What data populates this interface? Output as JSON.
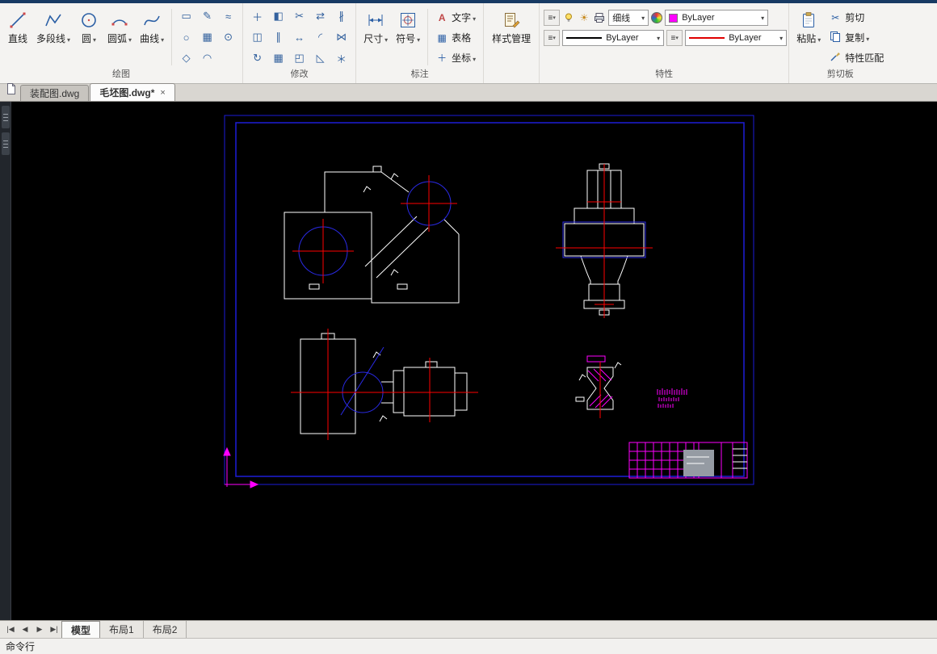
{
  "ribbon": {
    "panels": {
      "draw": {
        "label": "绘图",
        "big_buttons": [
          {
            "label": "直线"
          },
          {
            "label": "多段线"
          },
          {
            "label": "圆"
          },
          {
            "label": "圆弧"
          },
          {
            "label": "曲线"
          }
        ],
        "small_icons": [
          {
            "name": "rectangle",
            "glyph": "▭"
          },
          {
            "name": "ellipse",
            "glyph": "○"
          },
          {
            "name": "polygon",
            "glyph": "◇"
          },
          {
            "name": "sketch",
            "glyph": "✎"
          },
          {
            "name": "hatch",
            "glyph": "▦"
          },
          {
            "name": "arc-small",
            "glyph": "◠"
          },
          {
            "name": "wave",
            "glyph": "≈"
          },
          {
            "name": "point",
            "glyph": "⊙"
          }
        ]
      },
      "modify": {
        "label": "修改",
        "icons": [
          {
            "name": "move",
            "glyph": "＋"
          },
          {
            "name": "copy",
            "glyph": "◫"
          },
          {
            "name": "rotate",
            "glyph": "↻"
          },
          {
            "name": "mirror",
            "glyph": "◧"
          },
          {
            "name": "offset",
            "glyph": "∥"
          },
          {
            "name": "array",
            "glyph": "▦"
          },
          {
            "name": "trim",
            "glyph": "✂"
          },
          {
            "name": "extend",
            "glyph": "↔"
          },
          {
            "name": "scale",
            "glyph": "◰"
          },
          {
            "name": "stretch",
            "glyph": "⇄"
          },
          {
            "name": "fillet",
            "glyph": "◜"
          },
          {
            "name": "chamfer",
            "glyph": "◺"
          },
          {
            "name": "break",
            "glyph": "∦"
          },
          {
            "name": "join",
            "glyph": "⋈"
          },
          {
            "name": "explode",
            "glyph": "＊"
          }
        ]
      },
      "annotate": {
        "label": "标注",
        "big_buttons": [
          {
            "label": "尺寸"
          },
          {
            "label": "符号"
          }
        ],
        "small_buttons": [
          {
            "label": "文字"
          },
          {
            "label": "表格"
          },
          {
            "label": "坐标"
          }
        ]
      },
      "style": {
        "button_label": "样式管理"
      },
      "properties": {
        "label": "特性",
        "lineweight_value": "细线",
        "color_value": "ByLayer",
        "linetype_value": "ByLayer",
        "dimstyle_value": "ByLayer",
        "color_swatch": "#ff00ff",
        "linetype_sample_color": "#000000",
        "dimline_sample_color": "#e00000"
      },
      "clipboard": {
        "label": "剪切板",
        "paste_label": "粘贴",
        "small_buttons": [
          {
            "label": "剪切"
          },
          {
            "label": "复制"
          },
          {
            "label": "特性匹配"
          }
        ]
      }
    }
  },
  "document_tabs": {
    "tabs": [
      {
        "label": "装配图.dwg",
        "active": false
      },
      {
        "label": "毛坯图.dwg*",
        "active": true
      }
    ],
    "close_glyph": "×"
  },
  "layout_bar": {
    "nav": {
      "first": "|◀",
      "prev": "◀",
      "next": "▶",
      "last": "▶|"
    },
    "tabs": [
      {
        "label": "模型",
        "active": true
      },
      {
        "label": "布局1",
        "active": false
      },
      {
        "label": "布局2",
        "active": false
      }
    ]
  },
  "command_line": {
    "prompt": "命令行"
  },
  "canvas": {
    "background": "#000000",
    "frame_color": "#1d1dd8",
    "outline_color": "#ffffff",
    "centerline_color": "#ff0000",
    "feature_color": "#2a2ae6",
    "annotation_color": "#ff00ff"
  }
}
